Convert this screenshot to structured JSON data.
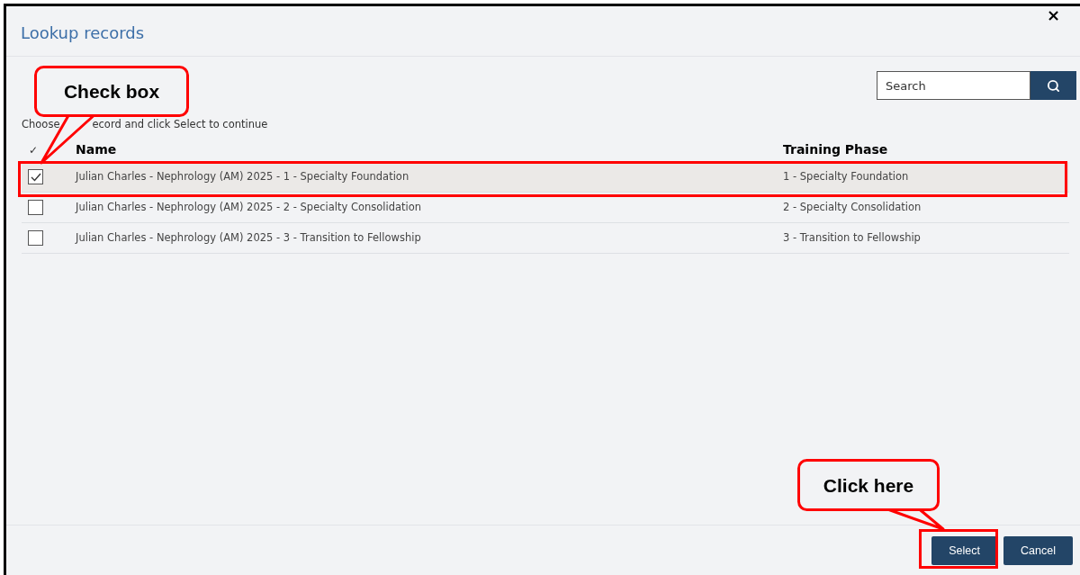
{
  "dialog": {
    "title": "Lookup records",
    "close": "×"
  },
  "search": {
    "placeholder": "Search"
  },
  "instruction": [
    "Choose",
    "ecord and click Select to continue"
  ],
  "table": {
    "select_all": "✓",
    "columns": [
      "Name",
      "Training Phase"
    ],
    "rows": [
      {
        "name": "Julian Charles - Nephrology (AM) 2025 - 1 - Specialty Foundation",
        "phase": "1 - Specialty Foundation",
        "checked": true,
        "selected": true
      },
      {
        "name": "Julian Charles - Nephrology (AM) 2025 - 2 - Specialty Consolidation",
        "phase": "2 - Specialty Consolidation",
        "checked": false,
        "selected": false
      },
      {
        "name": "Julian Charles - Nephrology (AM) 2025 - 3 - Transition to Fellowship",
        "phase": "3 - Transition to Fellowship",
        "checked": false,
        "selected": false
      }
    ]
  },
  "buttons": [
    "Select",
    "Cancel"
  ],
  "annotations": [
    {
      "kind": "callout",
      "text": "Check box"
    },
    {
      "kind": "callout",
      "text": "Click here"
    },
    {
      "kind": "highlight"
    },
    {
      "kind": "highlight"
    }
  ]
}
